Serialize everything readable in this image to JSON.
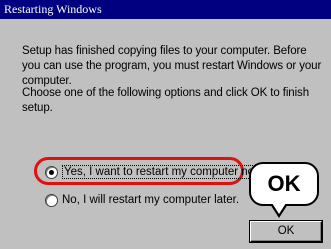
{
  "window": {
    "title": "Restarting Windows"
  },
  "message": {
    "line1": "Setup has finished copying files to your computer.  Before you can use the program, you must restart Windows or your computer.",
    "line2": "Choose one of the following options and click OK to finish setup."
  },
  "options": [
    {
      "label": "Yes, I want to restart my computer now.",
      "selected": true
    },
    {
      "label": "No, I will restart my computer later.",
      "selected": false
    }
  ],
  "annotation": {
    "callout_text": "OK",
    "highlight_color": "#e01010"
  },
  "buttons": {
    "ok_label": "OK"
  },
  "colors": {
    "titlebar": "#000080",
    "dialog_bg": "#c0c0c0"
  }
}
